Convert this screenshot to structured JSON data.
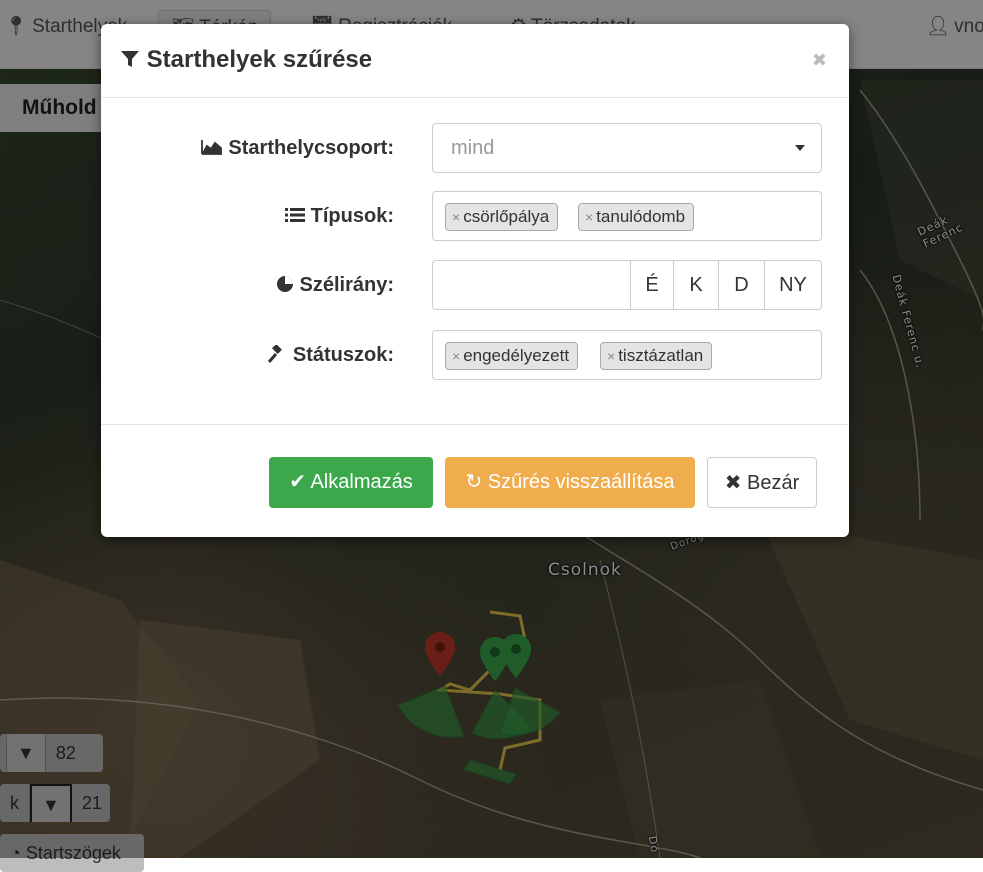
{
  "navbar": {
    "brand": "Starthelyek",
    "tabs": [
      {
        "label": "Térkép",
        "icon": "map-icon"
      },
      {
        "label": "Regisztrációk",
        "icon": "calendar-icon"
      },
      {
        "label": "Törzsadatok",
        "icon": "gear-icon"
      }
    ],
    "user": "vnorb"
  },
  "submenu": {
    "label": "Műhold"
  },
  "map": {
    "town_label": "Csolnok",
    "street_labels": [
      "Deák Ferenc",
      "Deák Ferenc u.",
      "Dorog",
      "Dó"
    ]
  },
  "controls": [
    {
      "label": "",
      "count": "82"
    },
    {
      "label": "k",
      "count": "21"
    },
    {
      "label": "Startszögek"
    }
  ],
  "modal": {
    "title": "Starthelyek szűrése",
    "fields": {
      "group": {
        "label": "Starthelycsoport:",
        "value": "mind"
      },
      "types": {
        "label": "Típusok:",
        "tags": [
          "csörlőpálya",
          "tanulódomb"
        ]
      },
      "wind": {
        "label": "Szélirány:",
        "value": "",
        "buttons": [
          "É",
          "K",
          "D",
          "NY"
        ]
      },
      "status": {
        "label": "Státuszok:",
        "tags": [
          "engedélyezett",
          "tisztázatlan"
        ]
      }
    },
    "buttons": {
      "apply": "Alkalmazás",
      "reset": "Szűrés visszaállítása",
      "close": "Bezár"
    }
  },
  "colors": {
    "apply": "#3aa84b",
    "reset": "#f0ad4e",
    "marker_red": "#c0392b",
    "marker_green": "#3aa84b",
    "track": "#e6c84a"
  }
}
